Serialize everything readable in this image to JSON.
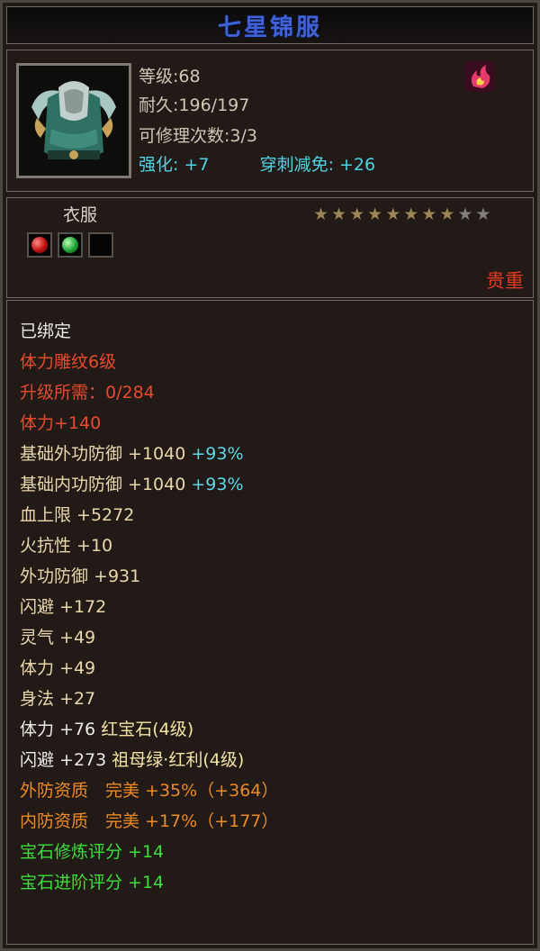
{
  "title": "七星锦服",
  "header": {
    "level_label": "等级:68",
    "durability_label": "耐久:196/197",
    "repair_label": "可修理次数:3/3",
    "enhance_label": "强化:",
    "enhance_value": "+7",
    "pierce_label": "穿刺减免:",
    "pierce_value": "+26",
    "portrait_icon": "armor-icon",
    "badge_icon": "flame-icon"
  },
  "slot": {
    "label": "衣服",
    "stars_total": 10,
    "stars_filled": 8,
    "gems": [
      "red-gem",
      "green-gem",
      "empty"
    ],
    "rarity": "贵重"
  },
  "attributes": [
    {
      "text": "已绑定",
      "color": "white"
    },
    {
      "text": "体力雕纹6级",
      "color": "red"
    },
    {
      "text": "升级所需：0/284",
      "color": "red"
    },
    {
      "text": "体力+140",
      "color": "red"
    },
    {
      "text": "基础外功防御 +1040",
      "extra": "+93%",
      "color": "gold"
    },
    {
      "text": "基础内功防御 +1040",
      "extra": "+93%",
      "color": "gold"
    },
    {
      "text": "血上限 +5272",
      "color": "gold"
    },
    {
      "text": "火抗性 +10",
      "color": "gold"
    },
    {
      "text": "外功防御 +931",
      "color": "gold"
    },
    {
      "text": "闪避 +172",
      "color": "gold"
    },
    {
      "text": "灵气 +49",
      "color": "gold"
    },
    {
      "text": "体力 +49",
      "color": "gold"
    },
    {
      "text": "身法 +27",
      "color": "gold"
    },
    {
      "text": "体力 +76",
      "extra": "红宝石(4级)",
      "color": "white",
      "extra_color": "yellow"
    },
    {
      "text": "闪避 +273",
      "extra": "祖母绿·红利(4级)",
      "color": "white",
      "extra_color": "yellow"
    },
    {
      "text": "外防资质　完美 +35%（+364）",
      "color": "orange"
    },
    {
      "text": "内防资质　完美 +17%（+177）",
      "color": "orange"
    },
    {
      "text": "宝石修炼评分 +14",
      "color": "green"
    },
    {
      "text": "宝石进阶评分 +14",
      "color": "green"
    }
  ],
  "colors": {
    "title": "#3f63d6",
    "cyan": "#4fd4e6",
    "red": "#e84a2e",
    "gold": "#e8d8aa",
    "orange": "#ee8a26",
    "green": "#3dde3a",
    "rarity": "#e63a22"
  }
}
